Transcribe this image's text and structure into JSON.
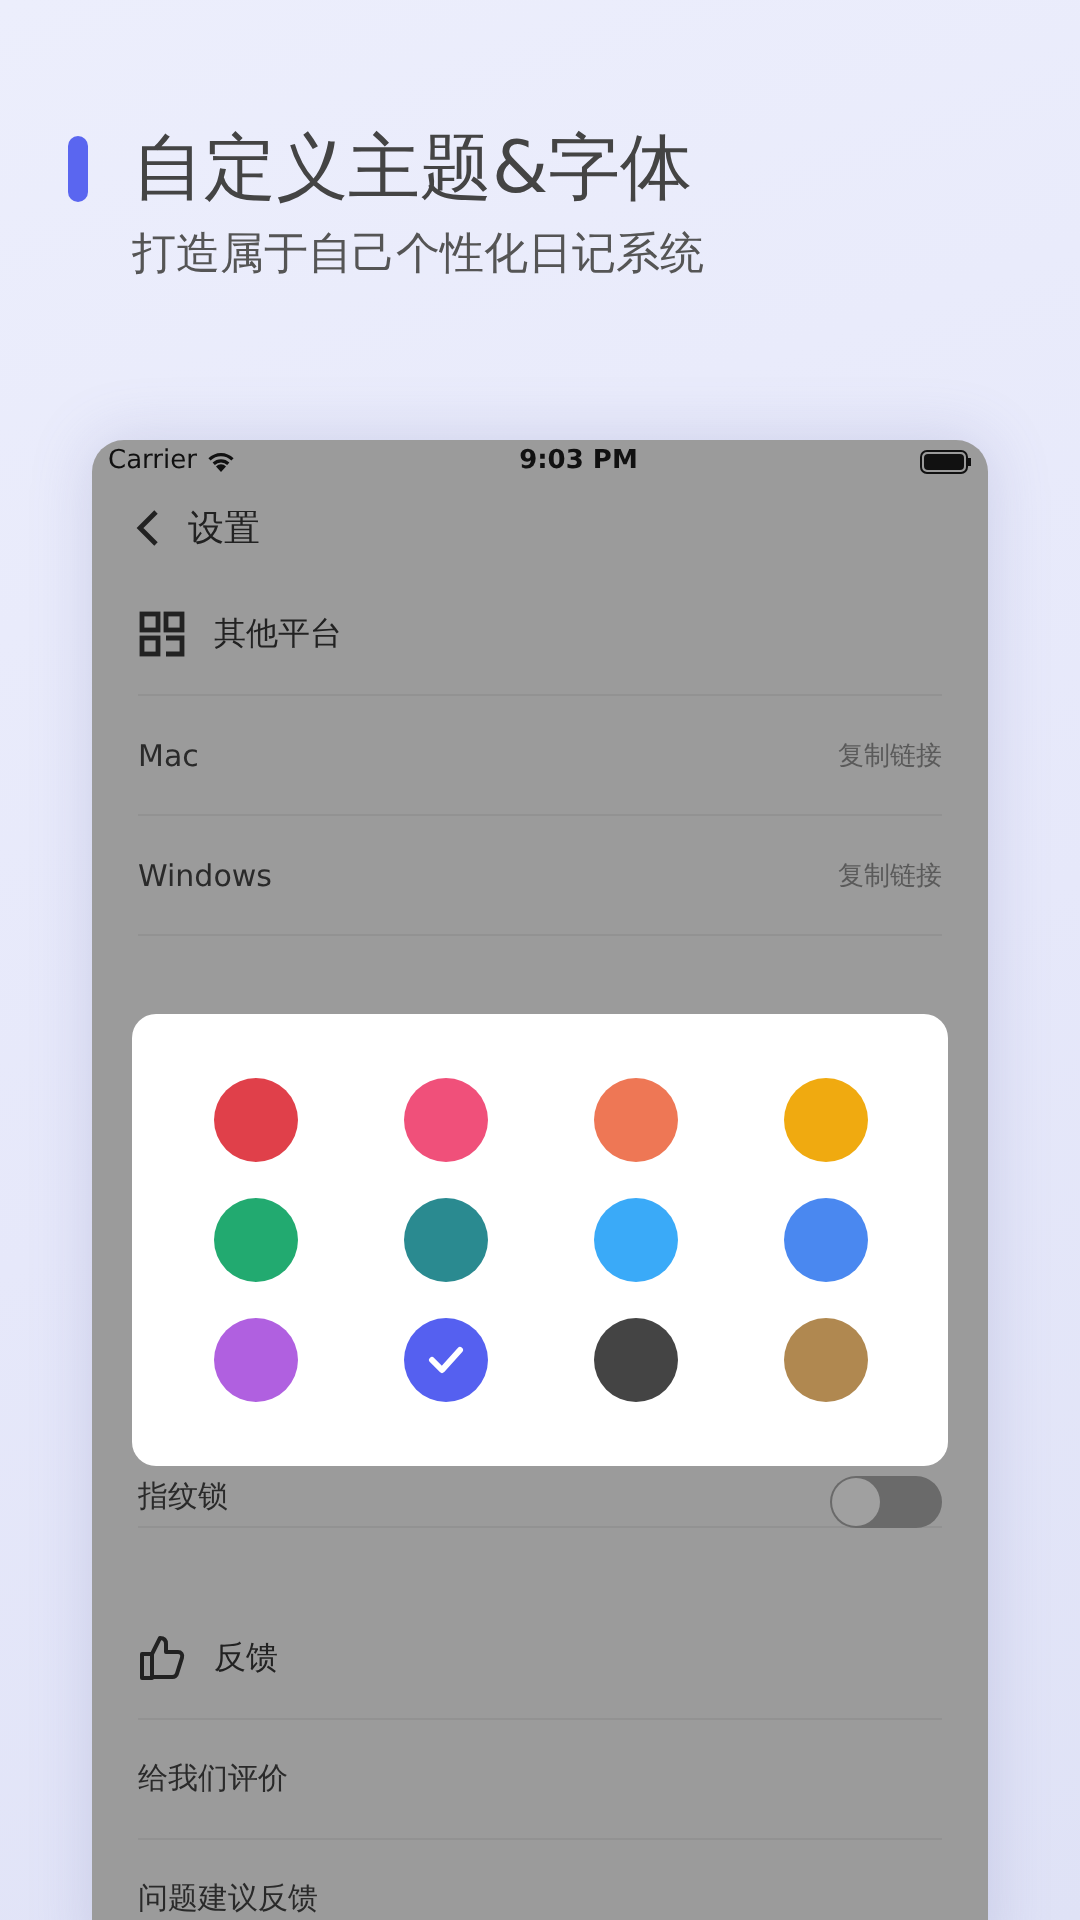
{
  "header": {
    "title": "自定义主题&字体",
    "subtitle": "打造属于自己个性化日记系统"
  },
  "status_bar": {
    "carrier": "Carrier",
    "time": "9:03 PM"
  },
  "nav": {
    "title": "设置"
  },
  "platforms": {
    "kind": "grid",
    "title": "其他平台",
    "rows": [
      {
        "label": "Mac",
        "action": "复制链接"
      },
      {
        "label": "Windows",
        "action": "复制链接"
      }
    ]
  },
  "fingerprint": {
    "label": "指纹锁",
    "on": false
  },
  "feedback": {
    "kind": "thumb",
    "title": "反馈",
    "rows": [
      {
        "label": "给我们评价"
      },
      {
        "label": "问题建议反馈"
      }
    ]
  },
  "color_picker": {
    "colors": [
      {
        "color": "#e0404a",
        "selected": false
      },
      {
        "color": "#f0507a",
        "selected": false
      },
      {
        "color": "#ee7755",
        "selected": false
      },
      {
        "color": "#f0aa10",
        "selected": false
      },
      {
        "color": "#22aa70",
        "selected": false
      },
      {
        "color": "#2a8a90",
        "selected": false
      },
      {
        "color": "#3aaaf8",
        "selected": false
      },
      {
        "color": "#4a88f0",
        "selected": false
      },
      {
        "color": "#b060e0",
        "selected": false
      },
      {
        "color": "#5560f0",
        "selected": true
      },
      {
        "color": "#444444",
        "selected": false
      },
      {
        "color": "#b08850",
        "selected": false
      }
    ]
  }
}
